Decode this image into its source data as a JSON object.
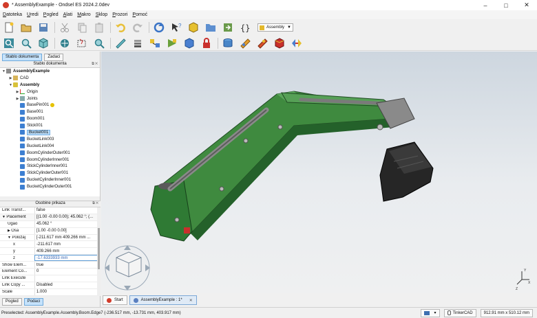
{
  "window": {
    "title": "* AssemblyExample - Ondsel ES 2024.2.0dev",
    "minimize": "–",
    "maximize": "□",
    "close": "✕"
  },
  "menu": [
    "Datoteka",
    "Uredi",
    "Pogled",
    "Alati",
    "Makro",
    "Sklop",
    "Prozori",
    "Pomoć"
  ],
  "toolbar": {
    "workbench": "Assembly"
  },
  "left_tabs": {
    "tree_tab": "Stablo dokumenta",
    "tasks_tab": "Zadaci"
  },
  "tree_panel": {
    "header": "Stablo dokumenta",
    "items": [
      {
        "label": "AssemblyExample",
        "level": 0,
        "arrow": "▼",
        "icon": "doc",
        "bold": true
      },
      {
        "label": "CAD",
        "level": 1,
        "arrow": "▶",
        "icon": "folder"
      },
      {
        "label": "Assembly",
        "level": 1,
        "arrow": "▼",
        "icon": "asm",
        "bold": true
      },
      {
        "label": "Origin",
        "level": 2,
        "arrow": "▶",
        "icon": "origin"
      },
      {
        "label": "Joints",
        "level": 2,
        "arrow": "▶",
        "icon": "joints"
      },
      {
        "label": "BasePin001",
        "level": 2,
        "arrow": "",
        "icon": "part",
        "badge": true
      },
      {
        "label": "Base001",
        "level": 2,
        "arrow": "",
        "icon": "part"
      },
      {
        "label": "Boom001",
        "level": 2,
        "arrow": "",
        "icon": "part"
      },
      {
        "label": "Stick001",
        "level": 2,
        "arrow": "",
        "icon": "part"
      },
      {
        "label": "Bucket001",
        "level": 2,
        "arrow": "",
        "icon": "part",
        "selected": true
      },
      {
        "label": "BucketLink003",
        "level": 2,
        "arrow": "",
        "icon": "part"
      },
      {
        "label": "BucketLink004",
        "level": 2,
        "arrow": "",
        "icon": "part"
      },
      {
        "label": "BoomCylinderOuter001",
        "level": 2,
        "arrow": "",
        "icon": "part"
      },
      {
        "label": "BoomCylinderInner001",
        "level": 2,
        "arrow": "",
        "icon": "part"
      },
      {
        "label": "StickCylinderInner001",
        "level": 2,
        "arrow": "",
        "icon": "part"
      },
      {
        "label": "StickCylinderOuter001",
        "level": 2,
        "arrow": "",
        "icon": "part"
      },
      {
        "label": "BucketCylinderInner001",
        "level": 2,
        "arrow": "",
        "icon": "part"
      },
      {
        "label": "BucketCylinderOuter001",
        "level": 2,
        "arrow": "",
        "icon": "part"
      }
    ]
  },
  "prop_panel": {
    "header": "Osobine prikaza",
    "rows": [
      {
        "name": "Link Transf...",
        "value": "false",
        "indent": 0,
        "arrow": ""
      },
      {
        "name": "Placement",
        "value": "[(1.00 -0.00 0.00); 45.062 °; (...",
        "indent": 0,
        "arrow": "▼",
        "group": true
      },
      {
        "name": "Ugao",
        "value": "45.062 °",
        "indent": 1,
        "arrow": ""
      },
      {
        "name": "Osa",
        "value": "[1.00 -0.00 0.00]",
        "indent": 1,
        "arrow": "▶"
      },
      {
        "name": "Položaj",
        "value": "[-211.617 mm  409.266 mm ...",
        "indent": 1,
        "arrow": "▼"
      },
      {
        "name": "x",
        "value": "-211.617 mm",
        "indent": 2,
        "arrow": ""
      },
      {
        "name": "y",
        "value": "409.266 mm",
        "indent": 2,
        "arrow": ""
      },
      {
        "name": "z",
        "value": "-17.6333933 mm",
        "indent": 2,
        "arrow": "",
        "editing": true
      },
      {
        "name": "Show Elem...",
        "value": "true",
        "indent": 0,
        "arrow": ""
      },
      {
        "name": "Element Co...",
        "value": "0",
        "indent": 0,
        "arrow": ""
      },
      {
        "name": "Link Execute",
        "value": "",
        "indent": 0,
        "arrow": ""
      },
      {
        "name": "Link Copy ...",
        "value": "Disabled",
        "indent": 0,
        "arrow": ""
      },
      {
        "name": "Scale",
        "value": "1.000",
        "indent": 0,
        "arrow": ""
      }
    ]
  },
  "bottom_tabs": {
    "view": "Pogled",
    "data": "Podaci"
  },
  "doc_tabs": [
    {
      "label": "Start",
      "active": false
    },
    {
      "label": "AssemblyExample : 1*",
      "active": true
    }
  ],
  "status": {
    "message": "Preselected: AssemblyExample.Assembly.Boom.Edge7 (-236.517 mm, -13.731 mm, 403.917 mm)",
    "nav_style": "TinkerCAD",
    "dimensions": "912.91 mm x 510.12 mm"
  },
  "colors": {
    "model_green": "#3f8a3f",
    "model_dark_green": "#24612a",
    "bucket": "#262626",
    "selection": "#b7daf7",
    "accent_blue": "#3d7fd1"
  }
}
